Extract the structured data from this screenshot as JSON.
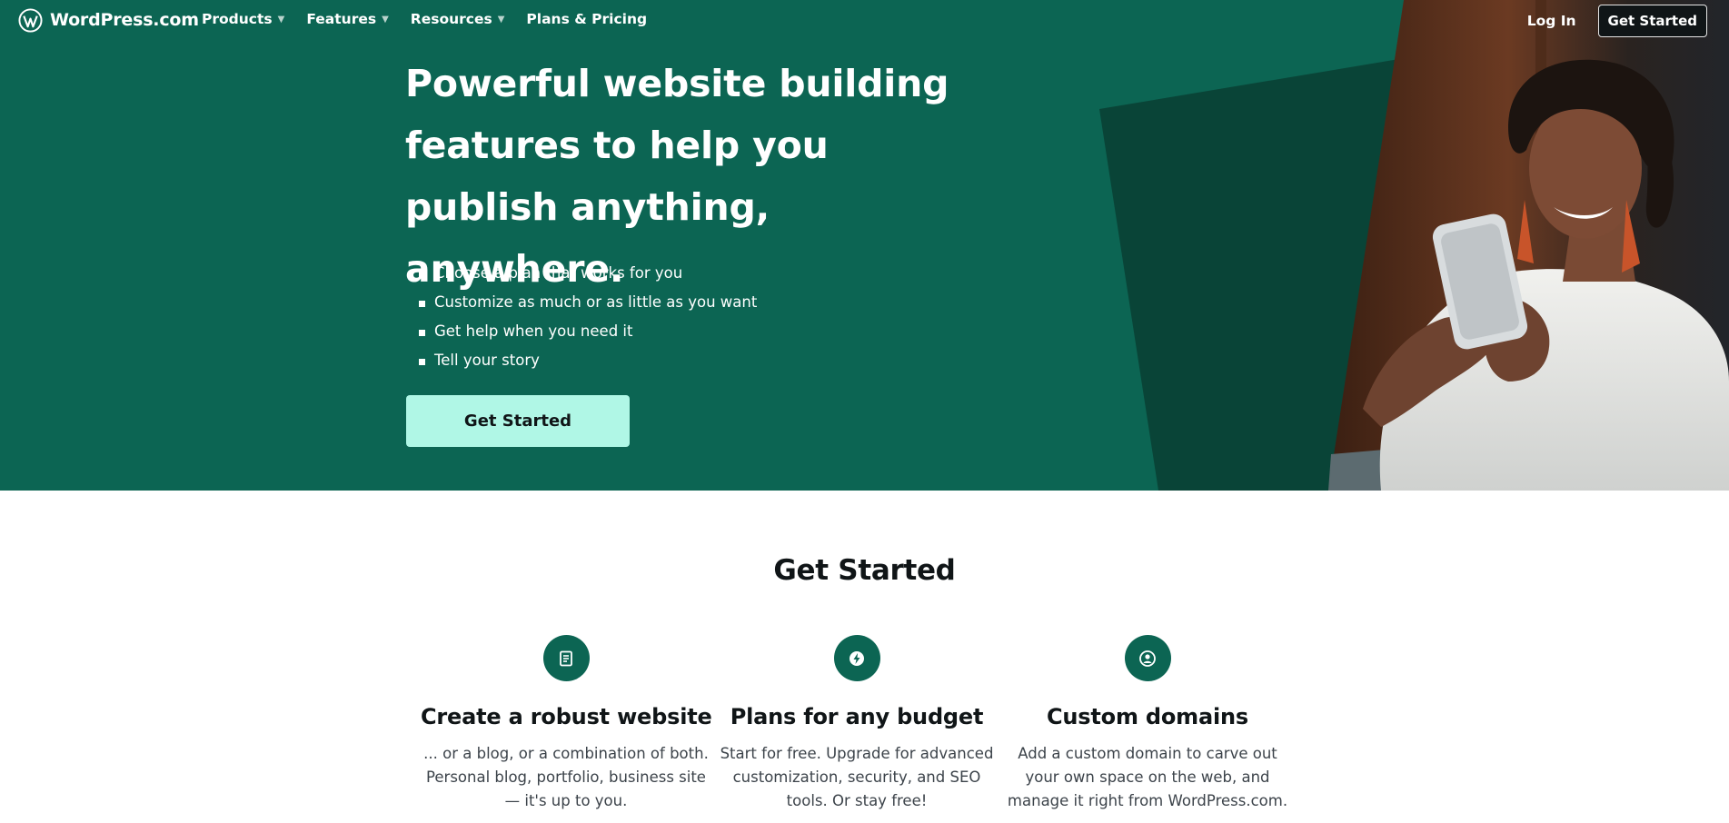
{
  "nav": {
    "logo_text": "WordPress.com",
    "menu": [
      {
        "label": "Products",
        "has_dropdown": true
      },
      {
        "label": "Features",
        "has_dropdown": true
      },
      {
        "label": "Resources",
        "has_dropdown": true
      },
      {
        "label": "Plans & Pricing",
        "has_dropdown": false
      }
    ],
    "login_label": "Log In",
    "cta_label": "Get Started"
  },
  "hero": {
    "title": "Powerful website building features to help you publish anything, anywhere.",
    "bullets": [
      "Choose a plan that works for you",
      "Customize as much or as little as you want",
      "Get help when you need it",
      "Tell your story"
    ],
    "cta_label": "Get Started",
    "image_icon": "woman-smiling-at-phone-photo"
  },
  "section": {
    "title": "Get Started",
    "features": [
      {
        "icon": "page-icon",
        "title": "Create a robust website",
        "description": "... or a blog, or a combination of both. Personal blog, portfolio, business site — it's up to you."
      },
      {
        "icon": "bolt-icon",
        "title": "Plans for any budget",
        "description": "Start for free. Upgrade for advanced customization, security, and SEO tools. Or stay free!"
      },
      {
        "icon": "user-circle-icon",
        "title": "Custom domains",
        "description": "Add a custom domain to carve out your own space on the web, and manage it right from WordPress.com."
      }
    ]
  },
  "colors": {
    "hero_green": "#0c6553",
    "hero_dark_green": "#094437",
    "cta_mint": "#b0f7e6",
    "text_dark": "#101517"
  }
}
